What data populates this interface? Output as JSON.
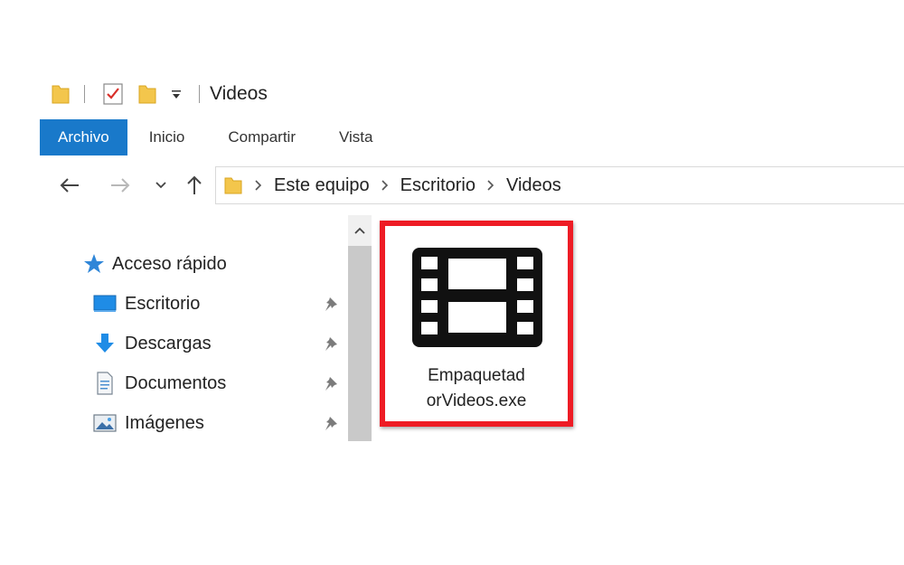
{
  "window": {
    "title": "Videos"
  },
  "quick_access_toolbar": {
    "icons": [
      "folder-icon",
      "properties-checkmark-icon",
      "new-folder-icon",
      "customize-dropdown-icon"
    ]
  },
  "ribbon": {
    "tabs": [
      {
        "label": "Archivo",
        "active": true
      },
      {
        "label": "Inicio"
      },
      {
        "label": "Compartir"
      },
      {
        "label": "Vista"
      }
    ]
  },
  "address_bar": {
    "breadcrumbs": [
      "Este equipo",
      "Escritorio",
      "Videos"
    ]
  },
  "navigation_pane": {
    "quick_access": {
      "label": "Acceso rápido"
    },
    "items": [
      {
        "label": "Escritorio",
        "icon": "desktop-icon",
        "pinned": true
      },
      {
        "label": "Descargas",
        "icon": "download-arrow-icon",
        "pinned": true
      },
      {
        "label": "Documentos",
        "icon": "document-icon",
        "pinned": true
      },
      {
        "label": "Imágenes",
        "icon": "pictures-icon",
        "pinned": true
      }
    ]
  },
  "files": [
    {
      "name_line1": "Empaquetad",
      "name_line2": "orVideos.exe",
      "icon": "film-strip-icon",
      "highlighted": true
    }
  ],
  "colors": {
    "accent": "#1979ca",
    "highlight": "#ee1c25"
  }
}
